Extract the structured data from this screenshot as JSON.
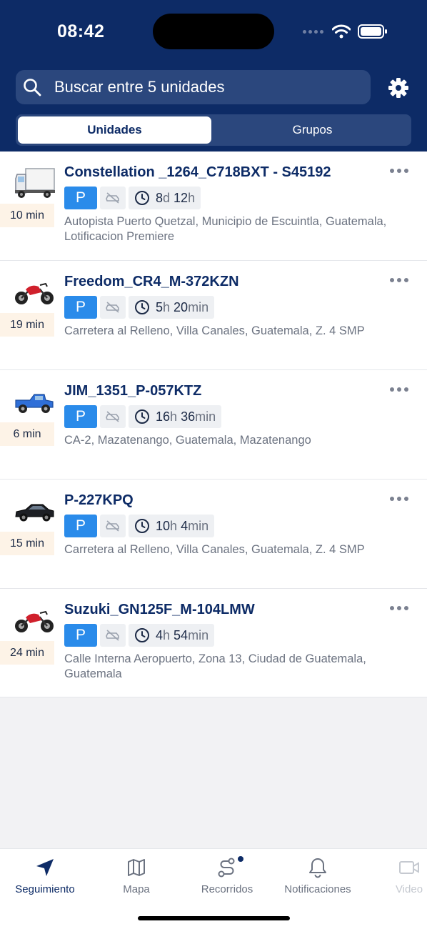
{
  "status_bar": {
    "time": "08:42"
  },
  "search": {
    "placeholder": "Buscar entre 5 unidades"
  },
  "segments": {
    "active": "Unidades",
    "inactive": "Grupos"
  },
  "vehicles": [
    {
      "name": "Constellation _1264_C718BXT - S45192",
      "ago": "10 min",
      "status": "P",
      "dur_a": "8",
      "unit_a": "d",
      "dur_b": "12",
      "unit_b": "h",
      "address": "Autopista Puerto Quetzal, Municipio de Escuintla, Guatemala, Lotificacion Premiere",
      "icon": "truck-icon"
    },
    {
      "name": "Freedom_CR4_M-372KZN",
      "ago": "19 min",
      "status": "P",
      "dur_a": "5",
      "unit_a": "h",
      "dur_b": "20",
      "unit_b": "min",
      "address": "Carretera al Relleno, Villa Canales, Guatemala, Z. 4 SMP",
      "icon": "motorcycle-icon"
    },
    {
      "name": "JIM_1351_P-057KTZ",
      "ago": "6 min",
      "status": "P",
      "dur_a": "16",
      "unit_a": "h",
      "dur_b": "36",
      "unit_b": "min",
      "address": "CA-2, Mazatenango, Guatemala, Mazatenango",
      "icon": "pickup-truck-icon"
    },
    {
      "name": "P-227KPQ",
      "ago": "15 min",
      "status": "P",
      "dur_a": "10",
      "unit_a": "h",
      "dur_b": "4",
      "unit_b": "min",
      "address": "Carretera al Relleno, Villa Canales, Guatemala, Z. 4 SMP",
      "icon": "car-icon"
    },
    {
      "name": "Suzuki_GN125F_M-104LMW",
      "ago": "24 min",
      "status": "P",
      "dur_a": "4",
      "unit_a": "h",
      "dur_b": "54",
      "unit_b": "min",
      "address": "Calle Interna Aeropuerto, Zona 13, Ciudad de Guatemala, Guatemala",
      "icon": "motorcycle-icon"
    }
  ],
  "tabbar": {
    "tracking": "Seguimiento",
    "map": "Mapa",
    "routes": "Recorridos",
    "notifications": "Notificaciones",
    "video": "Video"
  },
  "colors": {
    "header": "#0d2b66",
    "parked_badge": "#2a8bea",
    "time_badge_bg": "#fdf3e7"
  }
}
